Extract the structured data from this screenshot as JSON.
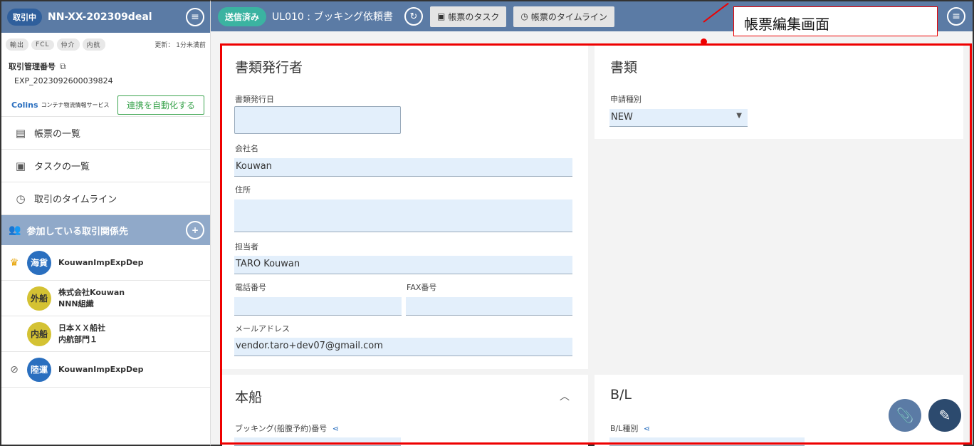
{
  "sidebar": {
    "status": "取引中",
    "deal_id": "NN-XX-202309deal",
    "tags": [
      "輸出",
      "FCL",
      "仲介",
      "内航"
    ],
    "updated": "更新： 1分未満前",
    "mgmt_label": "取引管理番号",
    "mgmt_value": "EXP_2023092600039824",
    "colins_logo": "Colins",
    "colins_sub": "コンテナ物流情報サービス",
    "auto_button": "連携を自動化する",
    "nav": [
      {
        "label": "帳票の一覧",
        "icon": "document-icon"
      },
      {
        "label": "タスクの一覧",
        "icon": "clipboard-icon"
      },
      {
        "label": "取引のタイムライン",
        "icon": "timeline-icon"
      }
    ],
    "party_header": "参加している取引関係先",
    "parties": [
      {
        "avatar": "海貨",
        "name": "KouwanImpExpDep",
        "name2": "",
        "lead": "crown-icon",
        "color": "blue"
      },
      {
        "avatar": "外船",
        "name": "株式会社Kouwan",
        "name2": "NNN組織",
        "lead": "",
        "color": "yellow"
      },
      {
        "avatar": "内船",
        "name": "日本ＸＸ船社",
        "name2": "内航部門１",
        "lead": "",
        "color": "yellow"
      },
      {
        "avatar": "陸運",
        "name": "KouwanImpExpDep",
        "name2": "",
        "lead": "eye-off-icon",
        "color": "blue"
      }
    ]
  },
  "topbar": {
    "sent": "送信済み",
    "title": "UL010 : ブッキング依頼書",
    "task_button": "帳票のタスク",
    "timeline_button": "帳票のタイムライン"
  },
  "form": {
    "issuer_title": "書類発行者",
    "issue_date_label": "書類発行日",
    "issue_date_value": "",
    "company_label": "会社名",
    "company_value": "Kouwan",
    "address_label": "住所",
    "address_value": "",
    "person_label": "担当者",
    "person_value": "TARO Kouwan",
    "phone_label": "電話番号",
    "phone_value": "",
    "fax_label": "FAX番号",
    "fax_value": "",
    "email_label": "メールアドレス",
    "email_value": "vendor.taro+dev07@gmail.com",
    "doc_title": "書類",
    "apply_type_label": "申請種別",
    "apply_type_value": "NEW",
    "vessel_title": "本船",
    "booking_label": "ブッキング(船腹予約)番号",
    "bl_title": "B/L",
    "bl_type_label": "B/L種別"
  },
  "annotation": {
    "callout": "帳票編集画面",
    "color": "#e00000"
  }
}
